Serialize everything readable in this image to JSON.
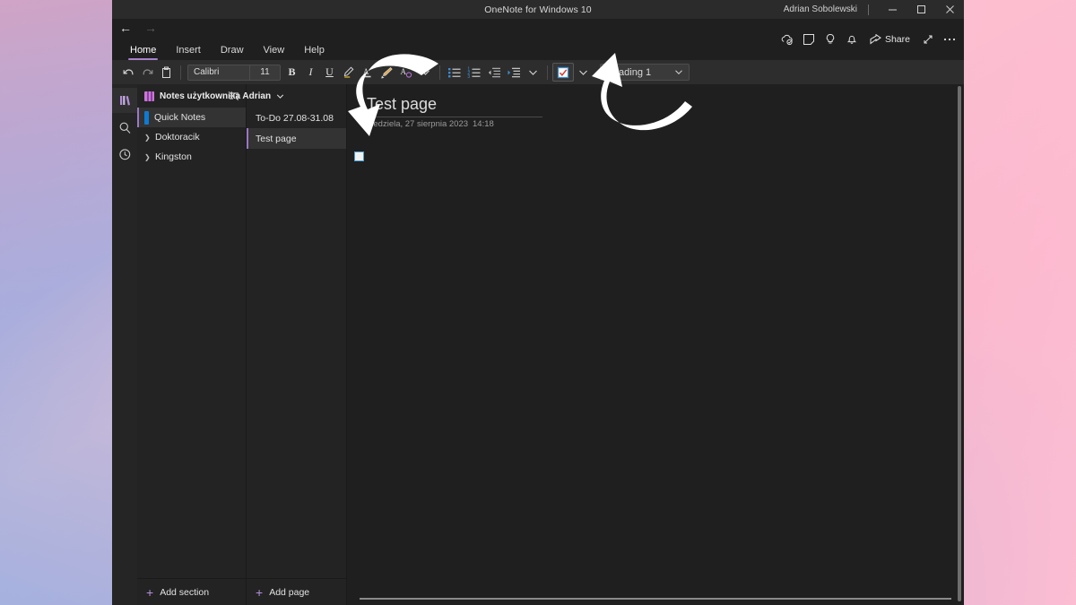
{
  "window": {
    "title": "OneNote for Windows 10",
    "user": "Adrian Sobolewski",
    "minimize": "minimize-icon",
    "maximize": "maximize-icon",
    "close": "close-icon"
  },
  "nav": {
    "back": "back-arrow-icon",
    "forward": "forward-arrow-icon",
    "tabs": [
      {
        "label": "Home",
        "active": true
      },
      {
        "label": "Insert",
        "active": false
      },
      {
        "label": "Draw",
        "active": false
      },
      {
        "label": "View",
        "active": false
      },
      {
        "label": "Help",
        "active": false
      }
    ],
    "right_icons": [
      "sync-cloud-icon",
      "sticky-note-icon",
      "lightbulb-icon",
      "bell-icon"
    ],
    "share_label": "Share",
    "fullscreen": "expand-diagonal-icon",
    "more": "ellipsis-icon"
  },
  "ribbon": {
    "undo": "undo-icon",
    "redo": "redo-icon",
    "clipboard": "clipboard-icon",
    "font_name": "Calibri",
    "font_size": "11",
    "bold": "B",
    "italic": "I",
    "underline": "U",
    "highlight_pen": "highlighter-pen-icon",
    "font_color": "font-color-icon",
    "text_highlight": "text-highlight-icon",
    "clear_format": "clear-formatting-icon",
    "more_font": "chevron-down-icon",
    "bullets": "bulleted-list-icon",
    "numbering": "numbered-list-icon",
    "decrease_indent": "decrease-indent-icon",
    "increase_indent": "increase-indent-icon",
    "more_para": "chevron-down-icon",
    "todo_tag": "todo-checkbox-tag-icon",
    "tag_dropdown": "chevron-down-icon",
    "style": "Heading 1",
    "style_dropdown": "chevron-down-icon",
    "accent_color": "#a882c8",
    "tag_check_color": "#d93a2b",
    "tag_box_color": "#3b8fd4"
  },
  "rail": {
    "notebooks": "notebooks-icon",
    "search": "search-icon",
    "recent": "recent-clock-icon"
  },
  "notebook": {
    "name": "Notes użytkownika Adrian",
    "chevron": "chevron-down-icon",
    "sort": "sort-icon",
    "color": "#c879d6",
    "sections": [
      {
        "label": "Quick Notes",
        "selected": true,
        "color": "#0e7ad4",
        "expandable": false
      },
      {
        "label": "Doktoracik",
        "selected": false,
        "color": "",
        "expandable": true
      },
      {
        "label": "Kingston",
        "selected": false,
        "color": "",
        "expandable": true
      }
    ],
    "add_section": "Add section"
  },
  "pages": {
    "items": [
      {
        "label": "To-Do 27.08-31.08",
        "selected": false
      },
      {
        "label": "Test page",
        "selected": true
      }
    ],
    "add_page": "Add page"
  },
  "page": {
    "title": "Test page",
    "date": "niedziela, 27 sierpnia 2023",
    "time": "14:18",
    "todo_checkbox": "unchecked-todo-checkbox",
    "todo_border_color": "#4a9fd4"
  },
  "annotations": {
    "arrow_to_checkbox": "curved-arrow-down-left",
    "arrow_to_todo_button": "curved-arrow-up-left",
    "color": "#ffffff"
  }
}
